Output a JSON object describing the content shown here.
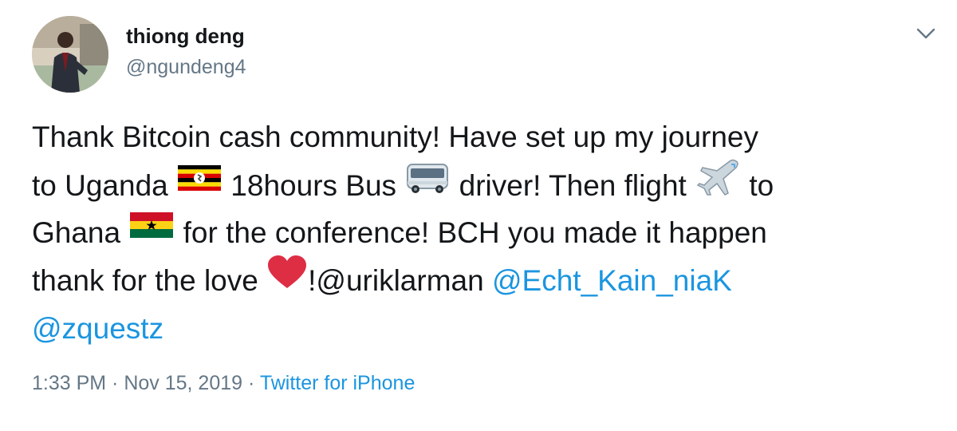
{
  "author": {
    "name": "thiong deng",
    "handle": "@ngundeng4"
  },
  "tweet": {
    "line1": "Thank Bitcoin cash community! Have set up my journey",
    "line2_a": "to Uganda ",
    "line2_b": " 18hours Bus ",
    "line2_c": " driver! Then flight ",
    "line2_d": " to",
    "line3_a": "Ghana ",
    "line3_b": " for the conference! BCH you made it happen",
    "line4_a": "thank for the love ",
    "line4_b": "!@uriklarman ",
    "mention_1": "@Echt_Kain_niaK",
    "mention_2": "@zquestz",
    "emojis": [
      "uganda-flag",
      "bus",
      "airplane",
      "ghana-flag",
      "red-heart"
    ]
  },
  "meta": {
    "time": "1:33 PM",
    "sep1": " · ",
    "date": "Nov 15, 2019",
    "sep2": " · ",
    "source": "Twitter for iPhone"
  },
  "colors": {
    "link": "#1b95e0",
    "secondary": "#657786",
    "text": "#14171a"
  }
}
